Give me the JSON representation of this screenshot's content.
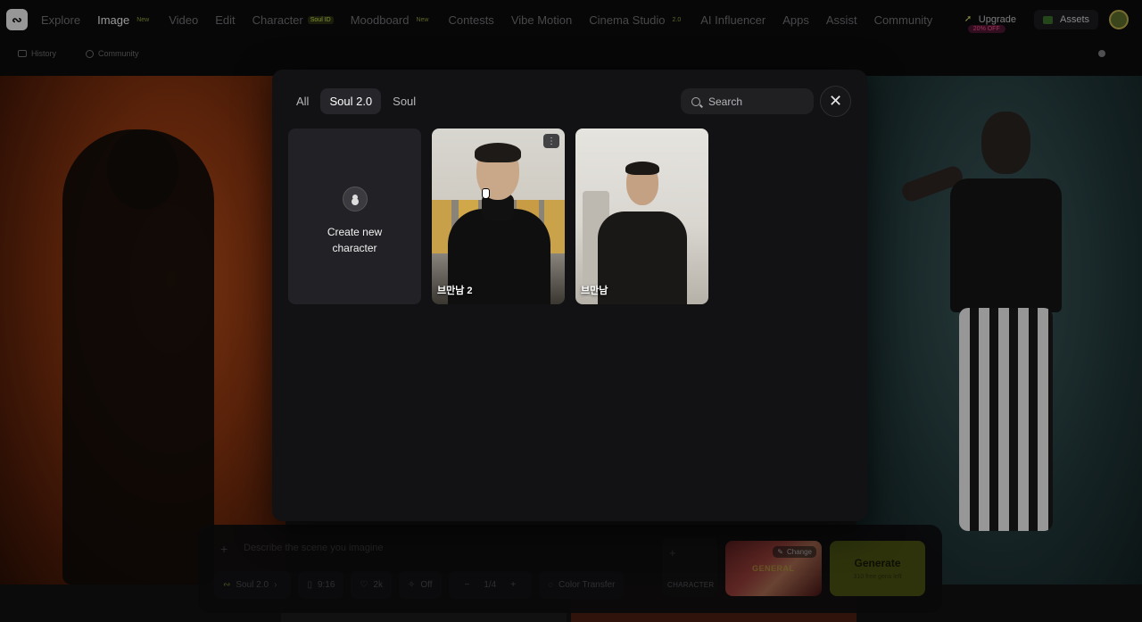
{
  "nav": {
    "items": [
      {
        "label": "Explore",
        "badge": ""
      },
      {
        "label": "Image",
        "badge": "New"
      },
      {
        "label": "Video",
        "badge": ""
      },
      {
        "label": "Edit",
        "badge": ""
      },
      {
        "label": "Character",
        "badge": "Soul ID"
      },
      {
        "label": "Moodboard",
        "badge": "New"
      },
      {
        "label": "Contests",
        "badge": ""
      },
      {
        "label": "Vibe Motion",
        "badge": ""
      },
      {
        "label": "Cinema Studio",
        "badge": "2.0"
      },
      {
        "label": "AI Influencer",
        "badge": ""
      },
      {
        "label": "Apps",
        "badge": ""
      },
      {
        "label": "Assist",
        "badge": ""
      },
      {
        "label": "Community",
        "badge": ""
      }
    ],
    "upgrade_label": "Upgrade",
    "upgrade_badge": "20% OFF",
    "assets_label": "Assets"
  },
  "subnav": {
    "history_label": "History",
    "community_label": "Community"
  },
  "modal": {
    "tabs": [
      "All",
      "Soul 2.0",
      "Soul"
    ],
    "active_tab": "Soul 2.0",
    "search_placeholder": "Search",
    "create_label": "Create new character",
    "characters": [
      {
        "name": "브만남 2"
      },
      {
        "name": "브만남"
      }
    ]
  },
  "composer": {
    "prompt_placeholder": "Describe the scene you imagine",
    "model": "Soul 2.0",
    "aspect": "9:16",
    "resolution": "2k",
    "enhance": "Off",
    "count": "1/4",
    "color_transfer": "Color Transfer",
    "character_label": "CHARACTER",
    "style_change": "Change",
    "style_label": "GENERAL",
    "generate_label": "Generate",
    "generate_sub": "310 free gens left"
  }
}
